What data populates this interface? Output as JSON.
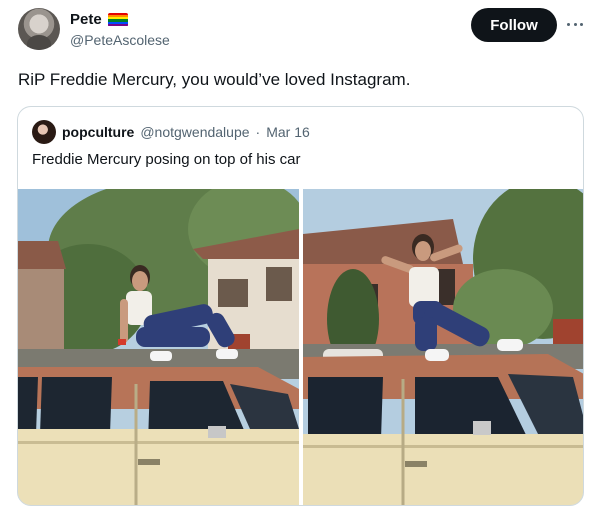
{
  "author": {
    "display_name": "Pete",
    "handle": "@PeteAscolese",
    "flag_colors": [
      "#e40303",
      "#ff8c00",
      "#ffed00",
      "#008026",
      "#004dff",
      "#750787"
    ]
  },
  "actions": {
    "follow_label": "Follow",
    "more_icon": "ellipsis-icon"
  },
  "tweet": {
    "text": "RiP Freddie Mercury, you would’ve loved Instagram."
  },
  "quoted": {
    "display_name": "popculture",
    "handle": "@notgwendalupe",
    "separator": "·",
    "date": "Mar 16",
    "text": "Freddie Mercury posing on top of his car"
  },
  "colors": {
    "text_primary": "#0f1419",
    "text_secondary": "#536471",
    "border": "#cfd9de",
    "button_bg": "#0f1419"
  }
}
